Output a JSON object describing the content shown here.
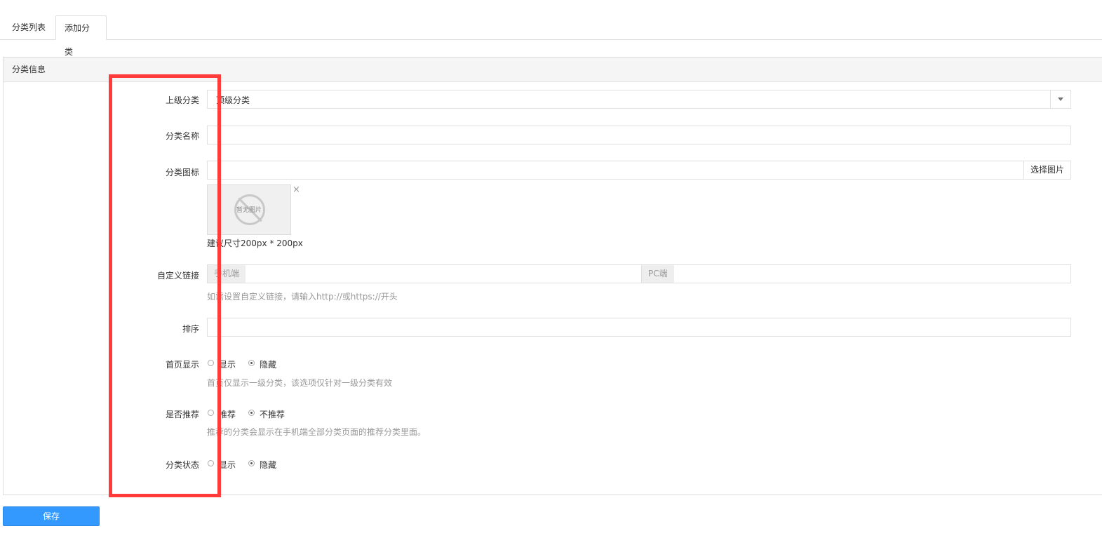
{
  "tabs": [
    {
      "label": "分类列表"
    },
    {
      "label": "添加分类"
    }
  ],
  "panel": {
    "title": "分类信息"
  },
  "form": {
    "parent": {
      "label": "上级分类",
      "value": "顶级分类"
    },
    "name": {
      "label": "分类名称",
      "value": ""
    },
    "icon": {
      "label": "分类图标",
      "value": "",
      "pick_button": "选择图片",
      "no_image_text": "暂无图片",
      "remove_glyph": "×",
      "hint": "建议尺寸200px * 200px"
    },
    "custom_link": {
      "label": "自定义链接",
      "mobile_addon": "手机端",
      "pc_addon": "PC端",
      "mobile_value": "",
      "pc_value": "",
      "help": "如需设置自定义链接，请输入http://或https://开头"
    },
    "sort": {
      "label": "排序",
      "value": ""
    },
    "home_display": {
      "label": "首页显示",
      "options": [
        "显示",
        "隐藏"
      ],
      "selected": "隐藏",
      "help": "首页仅显示一级分类，该选项仅针对一级分类有效"
    },
    "recommend": {
      "label": "是否推荐",
      "options": [
        "推荐",
        "不推荐"
      ],
      "selected": "不推荐",
      "help": "推荐的分类会显示在手机端全部分类页面的推荐分类里面。"
    },
    "status": {
      "label": "分类状态",
      "options": [
        "显示",
        "隐藏"
      ],
      "selected": "隐藏"
    }
  },
  "save_button": "保存",
  "colors": {
    "primary": "#3399ff",
    "highlight_box": "#ff3b3b"
  }
}
